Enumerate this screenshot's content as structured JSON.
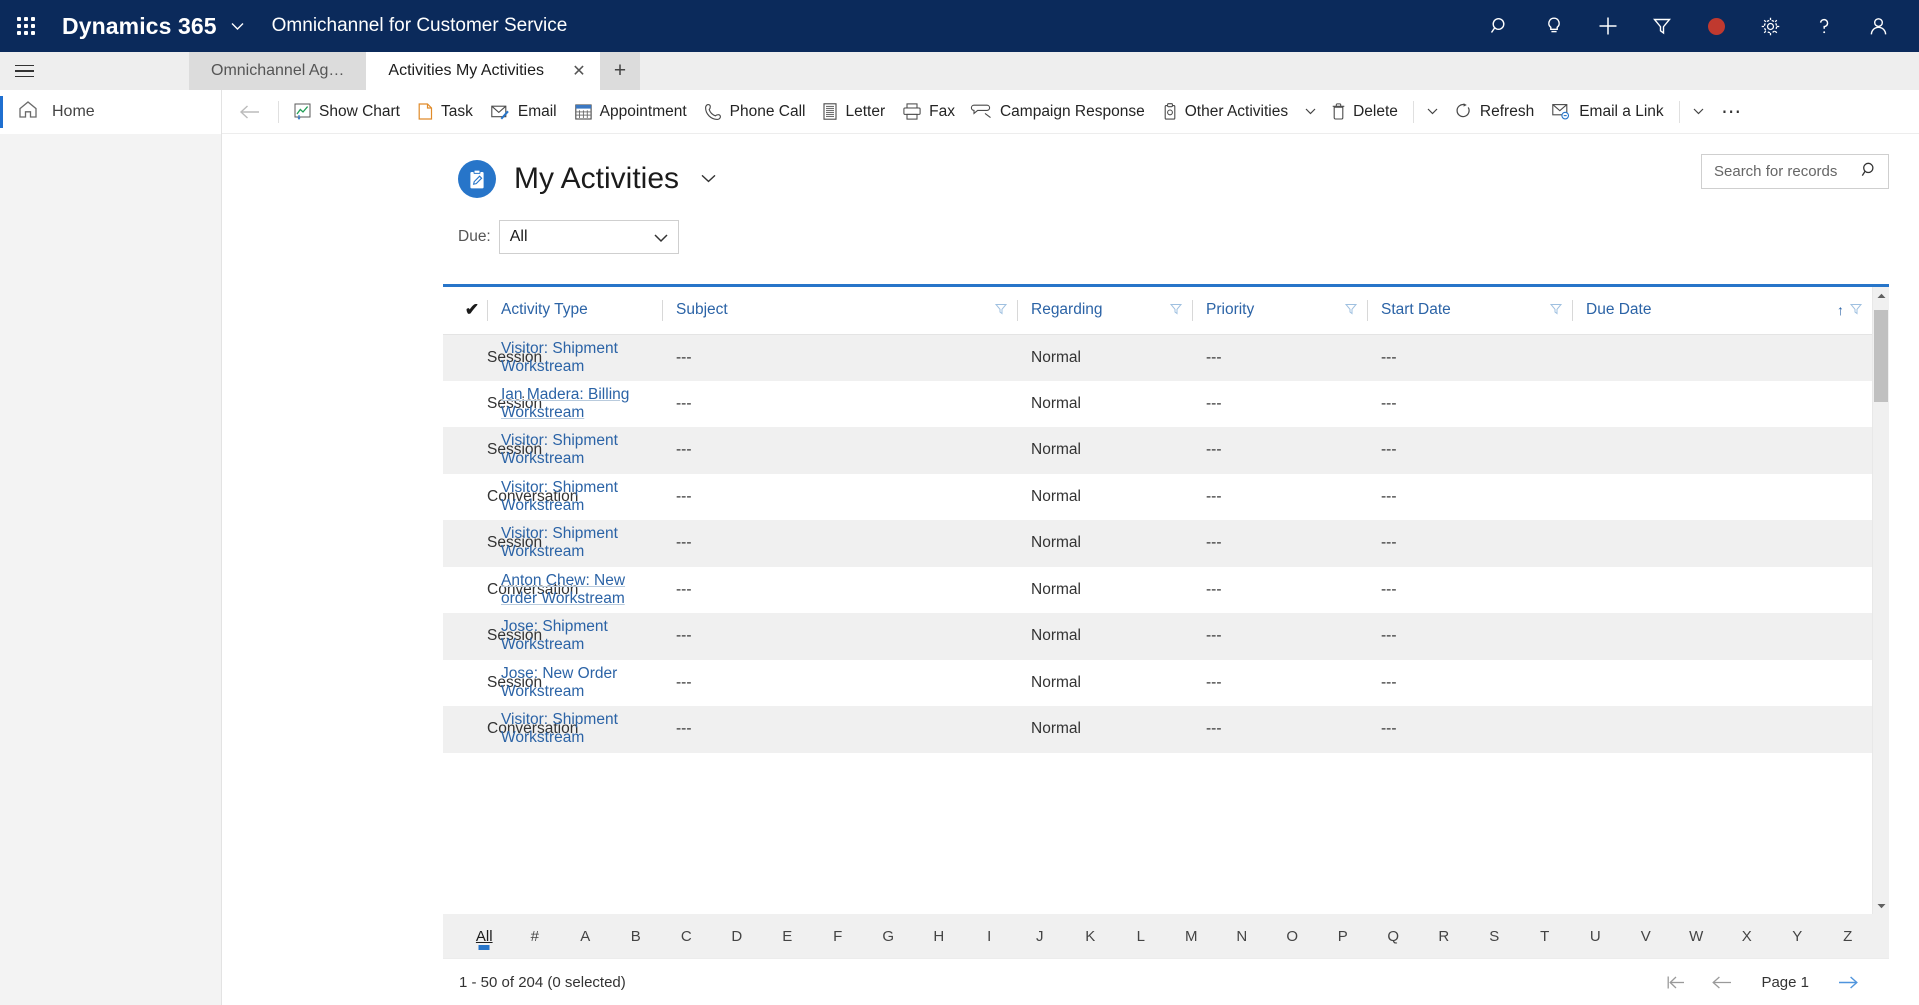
{
  "topbar": {
    "waffle_icon": "app-launcher-icon",
    "brand": "Dynamics 365",
    "brand_chevron": "⌄",
    "app_name": "Omnichannel for Customer Service",
    "icons": [
      {
        "name": "search-icon",
        "label": "Search"
      },
      {
        "name": "lightbulb-icon",
        "label": "Assistant"
      },
      {
        "name": "plus-icon",
        "label": "Quick create"
      },
      {
        "name": "filter-icon",
        "label": "Filter"
      },
      {
        "name": "presence-dot-icon",
        "label": "Presence",
        "color": "#c0392f"
      },
      {
        "name": "gear-icon",
        "label": "Settings"
      },
      {
        "name": "help-icon",
        "label": "Help"
      },
      {
        "name": "user-avatar-icon",
        "label": "Account"
      }
    ]
  },
  "tabstrip": {
    "hamburger_icon": "site-map-toggle-icon",
    "tabs": [
      {
        "label": "Omnichannel Ag…",
        "active": false,
        "closable": false
      },
      {
        "label": "Activities My Activities",
        "active": true,
        "closable": true
      }
    ],
    "close_glyph": "✕",
    "add_tab_label": "+"
  },
  "sidebar": {
    "items": [
      {
        "icon": "home-icon",
        "label": "Home",
        "selected": true
      }
    ]
  },
  "commandbar": {
    "back_label": "←",
    "buttons": [
      {
        "icon": "chart-icon",
        "label": "Show Chart",
        "caret": false
      },
      {
        "icon": "task-icon",
        "label": "Task",
        "caret": false
      },
      {
        "icon": "email-icon",
        "label": "Email",
        "caret": false
      },
      {
        "icon": "appointment-icon",
        "label": "Appointment",
        "caret": false
      },
      {
        "icon": "phone-icon",
        "label": "Phone Call",
        "caret": false
      },
      {
        "icon": "letter-icon",
        "label": "Letter",
        "caret": false
      },
      {
        "icon": "fax-icon",
        "label": "Fax",
        "caret": false
      },
      {
        "icon": "campaign-response-icon",
        "label": "Campaign Response",
        "caret": false
      },
      {
        "icon": "other-activities-icon",
        "label": "Other Activities",
        "caret": true
      },
      {
        "icon": "delete-icon",
        "label": "Delete",
        "caret": true,
        "divider_before": false,
        "divider_after": true
      },
      {
        "icon": "refresh-icon",
        "label": "Refresh",
        "caret": false
      },
      {
        "icon": "email-a-link-icon",
        "label": "Email a Link",
        "caret": true
      }
    ],
    "overflow_label": "⋯"
  },
  "view": {
    "icon": "activity-clipboard-icon",
    "icon_bg": "#2775c9",
    "title": "My Activities",
    "title_caret": "⌄"
  },
  "search": {
    "placeholder": "Search for records",
    "value": "",
    "icon": "search-icon"
  },
  "filter": {
    "label": "Due:",
    "value": "All",
    "caret": "⌄"
  },
  "grid": {
    "select_all_glyph": "✔",
    "columns": [
      {
        "label": "Activity Type",
        "filterable": false,
        "sorted": false
      },
      {
        "label": "Subject",
        "filterable": true,
        "sorted": false
      },
      {
        "label": "Regarding",
        "filterable": true,
        "sorted": false
      },
      {
        "label": "Priority",
        "filterable": true,
        "sorted": false
      },
      {
        "label": "Start Date",
        "filterable": true,
        "sorted": false
      },
      {
        "label": "Due Date",
        "filterable": true,
        "sorted": true,
        "sort_glyph": "↑"
      }
    ],
    "rows": [
      {
        "activity_type": "Session",
        "subject": "Visitor: Shipment Workstream",
        "regarding": "---",
        "priority": "Normal",
        "start_date": "---",
        "due_date": "---",
        "hovered": false
      },
      {
        "activity_type": "Session",
        "subject": "Ian Madera: Billing Workstream",
        "regarding": "---",
        "priority": "Normal",
        "start_date": "---",
        "due_date": "---",
        "hovered": true
      },
      {
        "activity_type": "Session",
        "subject": "Visitor: Shipment Workstream",
        "regarding": "---",
        "priority": "Normal",
        "start_date": "---",
        "due_date": "---",
        "hovered": false
      },
      {
        "activity_type": "Conversation",
        "subject": "Visitor: Shipment Workstream",
        "regarding": "---",
        "priority": "Normal",
        "start_date": "---",
        "due_date": "---",
        "hovered": false
      },
      {
        "activity_type": "Session",
        "subject": "Visitor: Shipment Workstream",
        "regarding": "---",
        "priority": "Normal",
        "start_date": "---",
        "due_date": "---",
        "hovered": false
      },
      {
        "activity_type": "Conversation",
        "subject": "Anton Chew: New order Workstream",
        "regarding": "---",
        "priority": "Normal",
        "start_date": "---",
        "due_date": "---",
        "hovered": true
      },
      {
        "activity_type": "Session",
        "subject": "Jose: Shipment Workstream",
        "regarding": "---",
        "priority": "Normal",
        "start_date": "---",
        "due_date": "---",
        "hovered": false
      },
      {
        "activity_type": "Session",
        "subject": "Jose: New Order Workstream",
        "regarding": "---",
        "priority": "Normal",
        "start_date": "---",
        "due_date": "---",
        "hovered": false
      },
      {
        "activity_type": "Conversation",
        "subject": "Visitor: Shipment Workstream",
        "regarding": "---",
        "priority": "Normal",
        "start_date": "---",
        "due_date": "---",
        "hovered": false
      }
    ]
  },
  "alphabet": {
    "selected": "All",
    "entries": [
      "All",
      "#",
      "A",
      "B",
      "C",
      "D",
      "E",
      "F",
      "G",
      "H",
      "I",
      "J",
      "K",
      "L",
      "M",
      "N",
      "O",
      "P",
      "Q",
      "R",
      "S",
      "T",
      "U",
      "V",
      "W",
      "X",
      "Y",
      "Z"
    ]
  },
  "footer": {
    "record_count": "1 - 50 of 204 (0 selected)",
    "page_label": "Page 1",
    "first_page_glyph": "⇤",
    "prev_page_glyph": "←",
    "next_page_glyph": "→"
  }
}
